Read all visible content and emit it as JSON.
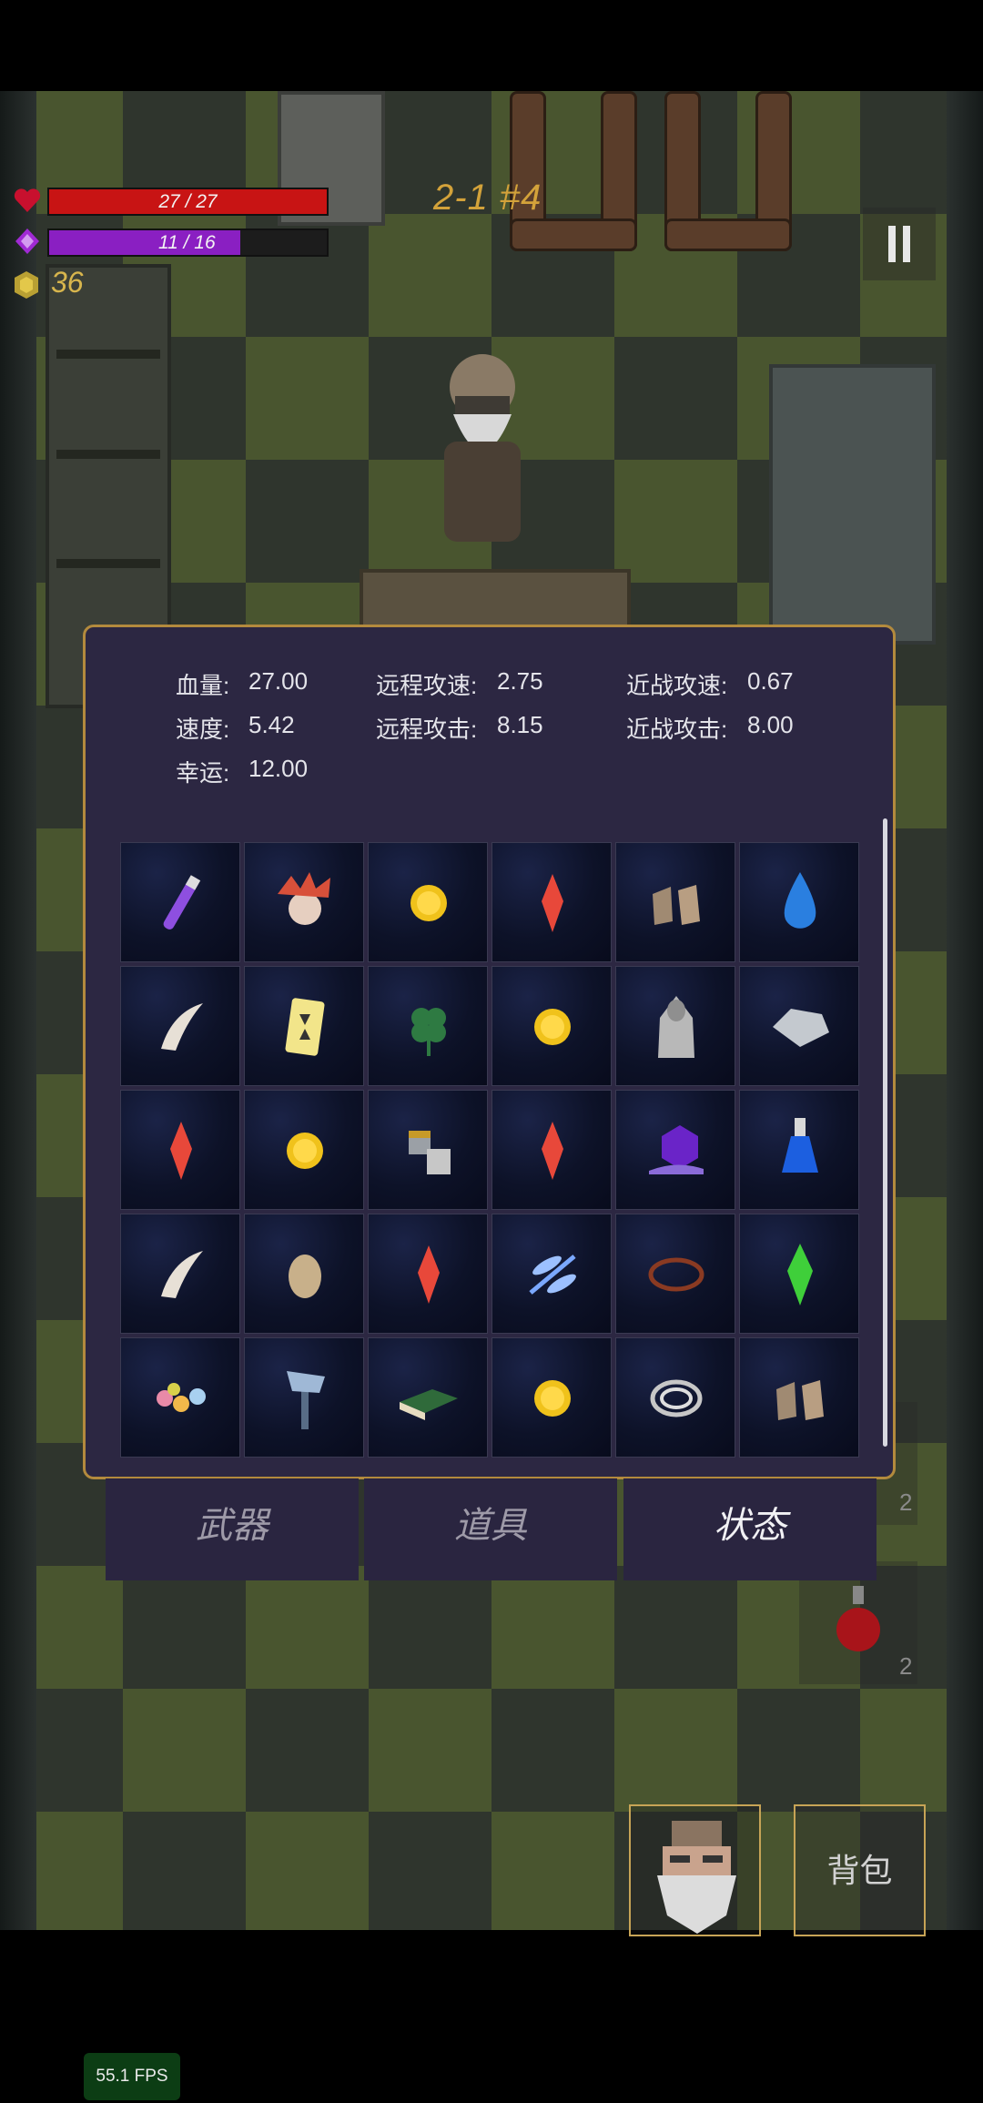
{
  "hud": {
    "hp_text": "27 / 27",
    "hp_fraction": 1.0,
    "mp_text": "11 / 16",
    "mp_fraction": 0.6875,
    "coins": "36",
    "level": "2-1 #4",
    "hp_color": "#c81414",
    "mp_color": "#8a1fc2",
    "coin_color": "#d7b54d"
  },
  "stats": {
    "hp": {
      "label": "血量:",
      "value": "27.00"
    },
    "ranged_speed": {
      "label": "远程攻速:",
      "value": "2.75"
    },
    "melee_speed": {
      "label": "近战攻速:",
      "value": "0.67"
    },
    "speed": {
      "label": "速度:",
      "value": "5.42"
    },
    "ranged_attack": {
      "label": "远程攻击:",
      "value": "8.15"
    },
    "melee_attack": {
      "label": "近战攻击:",
      "value": "8.00"
    },
    "luck": {
      "label": "幸运:",
      "value": "12.00"
    }
  },
  "inventory": [
    [
      "purple-vial-icon",
      "red-feather-mask-icon",
      "gold-coin-icon",
      "red-crystal-icon",
      "boots-icon",
      "blue-drop-icon"
    ],
    [
      "horn-icon",
      "yellow-card-icon",
      "clover-icon",
      "gold-coin-icon",
      "hooded-statue-icon",
      "silver-ore-icon"
    ],
    [
      "red-crystal-icon",
      "gold-coin-icon",
      "gauntlets-icon",
      "red-crystal-icon",
      "purple-snail-icon",
      "blue-potion-icon"
    ],
    [
      "horn-icon",
      "egg-icon",
      "red-crystal-icon",
      "dragonfly-icon",
      "thorn-ring-icon",
      "green-crystal-icon"
    ],
    [
      "flower-wreath-icon",
      "axe-icon",
      "green-book-icon",
      "gold-coin-icon",
      "silver-rings-icon",
      "boots-icon"
    ]
  ],
  "tabs": [
    {
      "label": "武器",
      "active": false
    },
    {
      "label": "道具",
      "active": false
    },
    {
      "label": "状态",
      "active": true
    }
  ],
  "shop_prices": [
    "2",
    "2"
  ],
  "bag_label": "背包",
  "fps": "55.1 FPS"
}
